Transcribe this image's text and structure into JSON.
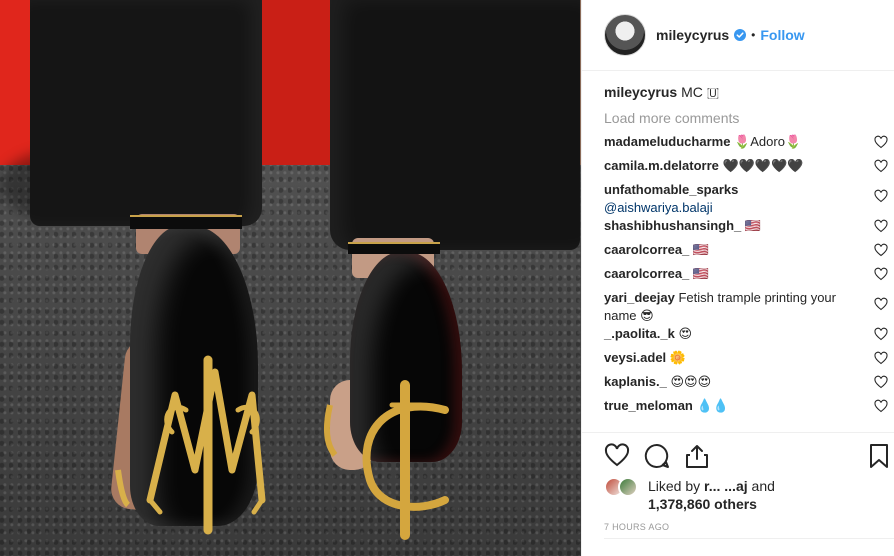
{
  "post": {
    "username": "mileycyrus",
    "follow_label": "Follow",
    "dot": "•",
    "caption": {
      "user": "mileycyrus",
      "text": "MC 🇺"
    }
  },
  "comments": {
    "load_more": "Load more comments",
    "items": [
      {
        "user": "madameluducharme",
        "text": "🌷Adoro🌷"
      },
      {
        "user": "camila.m.delatorre",
        "text": "🖤🖤🖤🖤🖤"
      },
      {
        "user": "unfathomable_sparks",
        "text": "",
        "mention": "@aishwariya.balaji"
      },
      {
        "user": "shashibhushansingh_",
        "text": "🇺🇸"
      },
      {
        "user": "caarolcorrea_",
        "text": "🇺🇸"
      },
      {
        "user": "caarolcorrea_",
        "text": "🇺🇸"
      },
      {
        "user": "yari_deejay",
        "text": "Fetish trample printing your name 😎"
      },
      {
        "user": "_.paolita._k",
        "text": "😍"
      },
      {
        "user": "veysi.adel",
        "text": "🌼"
      },
      {
        "user": "kaplanis._",
        "text": "😍😍😍"
      },
      {
        "user": "true_meloman",
        "text": "💧💧"
      }
    ]
  },
  "likes": {
    "prefix": "Liked by",
    "liker": "r... ...aj",
    "and": "and",
    "count": "1,378,860 others"
  },
  "timestamp": "7 HOURS AGO",
  "colors": {
    "link": "#3897f0",
    "muted": "#999999",
    "border": "#efefef",
    "text": "#262626"
  },
  "icons": [
    "heart-icon",
    "comment-icon",
    "share-icon",
    "bookmark-icon",
    "verified-badge-icon"
  ]
}
